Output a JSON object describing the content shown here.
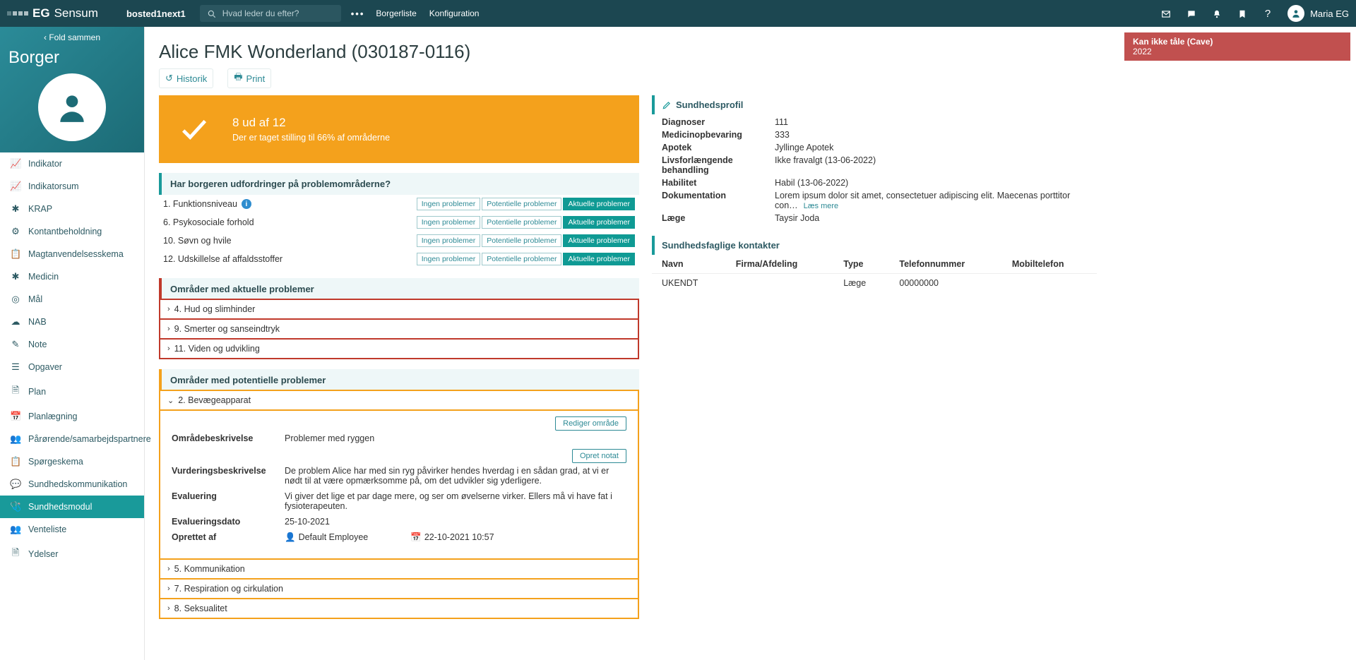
{
  "top": {
    "brand_eg": "EG",
    "brand_name": "Sensum",
    "context": "bosted1next1",
    "search_placeholder": "Hvad leder du efter?",
    "link_borgerliste": "Borgerliste",
    "link_konfiguration": "Konfiguration",
    "user_name": "Maria EG"
  },
  "sidebar": {
    "fold": "Fold sammen",
    "heading": "Borger",
    "items": [
      {
        "label": "Indikator"
      },
      {
        "label": "Indikatorsum"
      },
      {
        "label": "KRAP"
      },
      {
        "label": "Kontantbeholdning"
      },
      {
        "label": "Magtanvendelsesskema"
      },
      {
        "label": "Medicin"
      },
      {
        "label": "Mål"
      },
      {
        "label": "NAB"
      },
      {
        "label": "Note"
      },
      {
        "label": "Opgaver"
      },
      {
        "label": "Plan"
      },
      {
        "label": "Planlægning"
      },
      {
        "label": "Pårørende/samarbejdspartnere"
      },
      {
        "label": "Spørgeskema"
      },
      {
        "label": "Sundhedskommunikation"
      },
      {
        "label": "Sundhedsmodul"
      },
      {
        "label": "Venteliste"
      },
      {
        "label": "Ydelser"
      }
    ],
    "active_index": 15
  },
  "alert": {
    "title": "Kan ikke tåle (Cave)",
    "year": "2022"
  },
  "page": {
    "title": "Alice FMK Wonderland (030187-0116)",
    "action_historik": "Historik",
    "action_print": "Print"
  },
  "progress": {
    "headline": "8 ud af 12",
    "subline": "Der er taget stilling til 66% af områderne"
  },
  "questions": {
    "heading": "Har borgeren udfordringer på problemområderne?",
    "opt_none": "Ingen problemer",
    "opt_pot": "Potentielle problemer",
    "opt_act": "Aktuelle problemer",
    "rows": [
      {
        "label": "1. Funktionsniveau",
        "info": true
      },
      {
        "label": "6. Psykosociale forhold"
      },
      {
        "label": "10. Søvn og hvile"
      },
      {
        "label": "12. Udskillelse af affaldsstoffer"
      }
    ]
  },
  "actual": {
    "heading": "Områder med aktuelle problemer",
    "rows": [
      {
        "label": "4. Hud og slimhinder"
      },
      {
        "label": "9. Smerter og sanseindtryk"
      },
      {
        "label": "11. Viden og udvikling"
      }
    ]
  },
  "potential": {
    "heading": "Områder med potentielle problemer",
    "open": {
      "title": "2. Bevægeapparat",
      "btn_edit": "Rediger område",
      "btn_note": "Opret notat",
      "k_area": "Områdebeskrivelse",
      "v_area": "Problemer med ryggen",
      "k_assess": "Vurderingsbeskrivelse",
      "v_assess": "De problem Alice har med sin ryg påvirker hendes hverdag i en sådan grad, at vi er nødt til at være opmærksomme på, om det udvikler sig yderligere.",
      "k_eval": "Evaluering",
      "v_eval": "Vi giver det lige et par dage mere, og ser om øvelserne virker. Ellers må vi have fat i fysioterapeuten.",
      "k_evaldate": "Evalueringsdato",
      "v_evaldate": "25-10-2021",
      "k_created": "Oprettet af",
      "v_created_by": "Default Employee",
      "v_created_ts": "22-10-2021 10:57"
    },
    "rows": [
      {
        "label": "5. Kommunikation"
      },
      {
        "label": "7. Respiration og cirkulation"
      },
      {
        "label": "8. Seksualitet"
      }
    ]
  },
  "profile": {
    "heading": "Sundhedsprofil",
    "rows": [
      {
        "k": "Diagnoser",
        "v": "111"
      },
      {
        "k": "Medicinopbevaring",
        "v": "333"
      },
      {
        "k": "Apotek",
        "v": "Jyllinge Apotek"
      },
      {
        "k": "Livsforlængende behandling",
        "v": "Ikke fravalgt (13-06-2022)"
      },
      {
        "k": "Habilitet",
        "v": "Habil (13-06-2022)"
      },
      {
        "k": "Dokumentation",
        "v": "Lorem ipsum dolor sit amet, consectetuer adipiscing elit. Maecenas porttitor con…",
        "more": "Læs mere"
      },
      {
        "k": "Læge",
        "v": "Taysir Joda"
      }
    ]
  },
  "contacts": {
    "heading": "Sundhedsfaglige kontakter",
    "columns": [
      "Navn",
      "Firma/Afdeling",
      "Type",
      "Telefonnummer",
      "Mobiltelefon"
    ],
    "rows": [
      {
        "navn": "UKENDT",
        "firma": "",
        "type": "Læge",
        "tlf": "00000000",
        "mobil": ""
      }
    ]
  }
}
